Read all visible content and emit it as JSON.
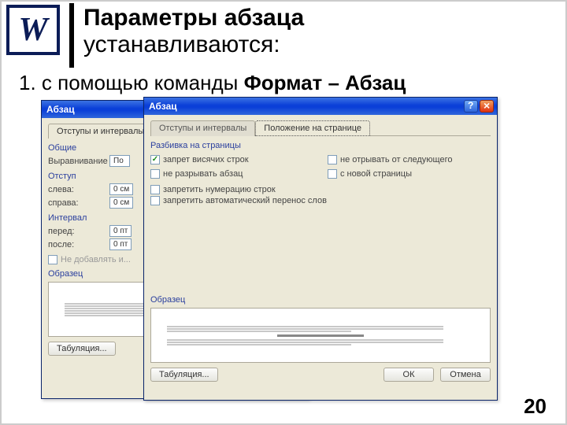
{
  "header": {
    "icon_letter": "W",
    "title_bold": "Параметры абзаца",
    "title_regular": "устанавливаются:"
  },
  "subtitle": {
    "prefix": "1. с помощью команды ",
    "bold": "Формат – Абзац"
  },
  "page_number": "20",
  "dialog_back": {
    "title": "Абзац",
    "tab_active": "Отступы и интервалы",
    "group_general": "Общие",
    "label_alignment": "Выравнивание",
    "value_alignment": "По",
    "group_indent": "Отступ",
    "label_left": "слева:",
    "value_left": "0 см",
    "label_right": "справа:",
    "value_right": "0 см",
    "group_interval": "Интервал",
    "label_before": "перед:",
    "value_before": "0 пт",
    "label_after": "после:",
    "value_after": "0 пт",
    "chk_no_add": "Не добавлять и...",
    "group_sample": "Образец",
    "btn_tabs": "Табуляция..."
  },
  "dialog_front": {
    "title": "Абзац",
    "tab_inactive": "Отступы и интервалы",
    "tab_active": "Положение на странице",
    "group_pagination": "Разбивка на страницы",
    "chk_widow": "запрет висячих строк",
    "chk_keep_next": "не отрывать от следующего",
    "chk_keep_together": "не разрывать абзац",
    "chk_page_break": "с новой страницы",
    "chk_suppress_lines": "запретить нумерацию строк",
    "chk_suppress_hyphen": "запретить автоматический перенос слов",
    "group_sample": "Образец",
    "btn_tabs": "Табуляция...",
    "btn_ok": "ОК",
    "btn_cancel": "Отмена"
  }
}
